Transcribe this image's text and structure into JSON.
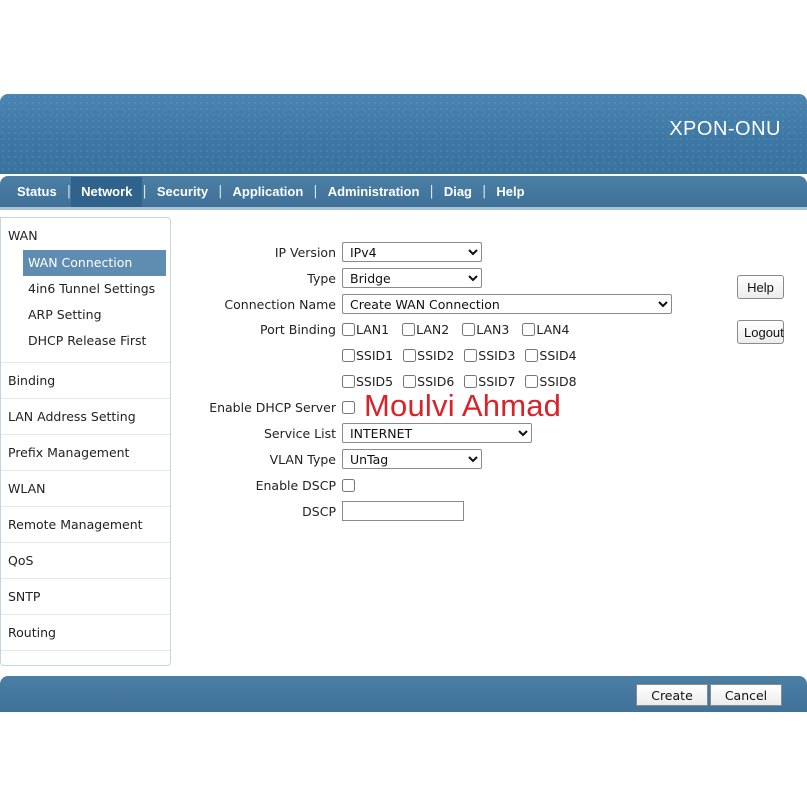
{
  "header": {
    "brand": "XPON-ONU"
  },
  "nav": {
    "items": [
      {
        "label": "Status"
      },
      {
        "label": "Network"
      },
      {
        "label": "Security"
      },
      {
        "label": "Application"
      },
      {
        "label": "Administration"
      },
      {
        "label": "Diag"
      },
      {
        "label": "Help"
      }
    ],
    "active": "Network"
  },
  "sidebar": {
    "wan": {
      "title": "WAN",
      "items": [
        "WAN Connection",
        "4in6 Tunnel Settings",
        "ARP Setting",
        "DHCP Release First"
      ]
    },
    "groups": [
      "Binding",
      "LAN Address Setting",
      "Prefix Management",
      "WLAN",
      "Remote Management",
      "QoS",
      "SNTP",
      "Routing"
    ]
  },
  "form": {
    "ip_version": {
      "label": "IP Version",
      "value": "IPv4"
    },
    "type": {
      "label": "Type",
      "value": "Bridge"
    },
    "connection_name": {
      "label": "Connection Name",
      "value": "Create WAN Connection"
    },
    "port_binding": {
      "label": "Port Binding",
      "lan": [
        "LAN1",
        "LAN2",
        "LAN3",
        "LAN4"
      ],
      "ssid_row1": [
        "SSID1",
        "SSID2",
        "SSID3",
        "SSID4"
      ],
      "ssid_row2": [
        "SSID5",
        "SSID6",
        "SSID7",
        "SSID8"
      ]
    },
    "enable_dhcp_server": {
      "label": "Enable DHCP Server"
    },
    "service_list": {
      "label": "Service List",
      "value": "INTERNET"
    },
    "vlan_type": {
      "label": "VLAN Type",
      "value": "UnTag"
    },
    "enable_dscp": {
      "label": "Enable DSCP"
    },
    "dscp": {
      "label": "DSCP",
      "value": ""
    }
  },
  "watermark": "Moulvi Ahmad",
  "buttons": {
    "help": "Help",
    "logout": "Logout",
    "create": "Create",
    "cancel": "Cancel"
  },
  "colors": {
    "header_blue": "#3d77a4",
    "nav_active": "#2f638c",
    "sidebar_active": "#5f8db2",
    "watermark": "#d8232a"
  }
}
